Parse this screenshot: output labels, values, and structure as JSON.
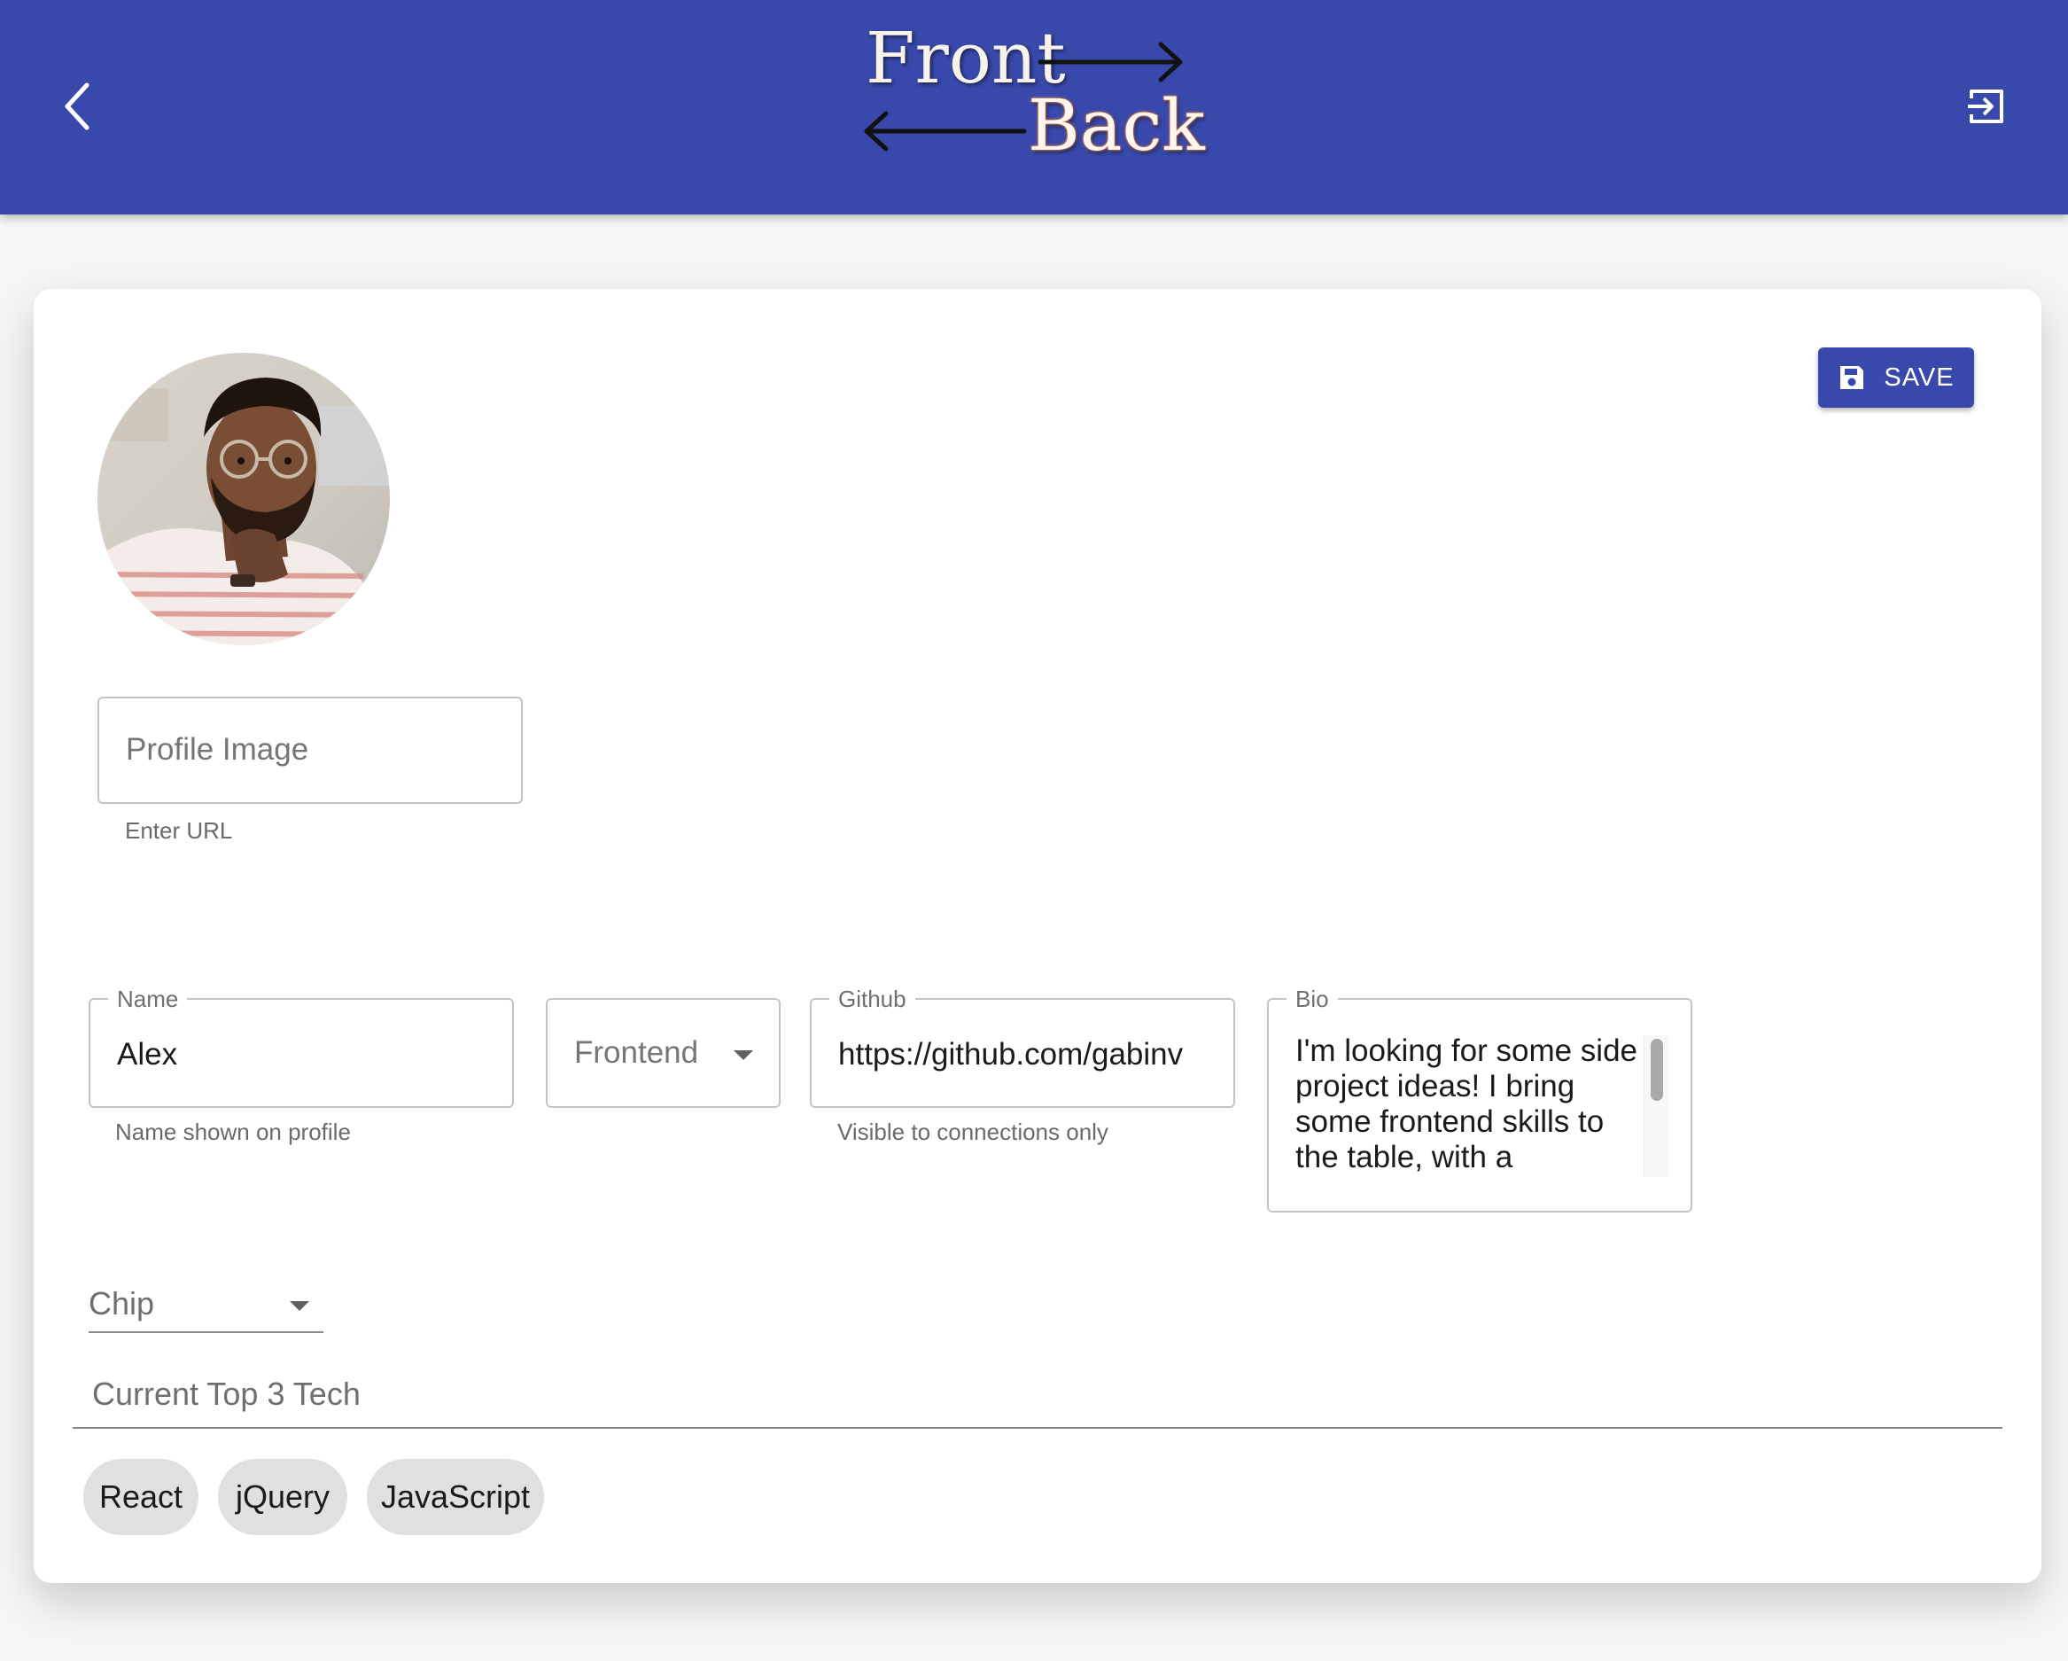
{
  "header": {
    "logo_front": "Front",
    "logo_back": "Back",
    "back_icon": "chevron-left-icon",
    "logout_icon": "exit-to-app-icon",
    "color": "#3949ab"
  },
  "save_button": {
    "label": "SAVE",
    "icon": "save-icon"
  },
  "profile_image": {
    "placeholder": "Profile Image",
    "helper": "Enter URL"
  },
  "name": {
    "label": "Name",
    "value": "Alex",
    "helper": "Name shown on profile"
  },
  "role_select": {
    "value": "Frontend"
  },
  "github": {
    "label": "Github",
    "value": "https://github.com/gabinv",
    "helper": "Visible to connections only"
  },
  "bio": {
    "label": "Bio",
    "value": "I'm looking for some side project ideas!  I bring some frontend skills to the table, with a"
  },
  "chip_select": {
    "value": "Chip"
  },
  "tech": {
    "placeholder": "Current Top 3 Tech",
    "chips": [
      "React",
      "jQuery",
      "JavaScript"
    ]
  }
}
